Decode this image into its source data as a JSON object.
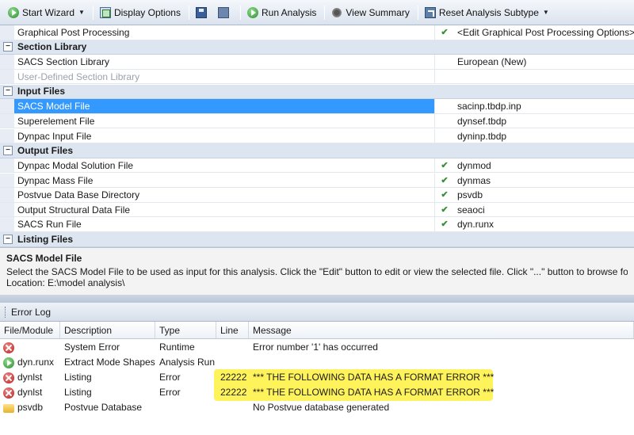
{
  "toolbar": {
    "start_wizard": "Start Wizard",
    "display_options": "Display Options",
    "run_analysis": "Run Analysis",
    "view_summary": "View Summary",
    "reset_subtype": "Reset Analysis Subtype"
  },
  "grid": {
    "rows": [
      {
        "type": "prop",
        "name": "Graphical Post Processing",
        "check": "✔",
        "value": "<Edit Graphical Post Processing Options>"
      },
      {
        "type": "cat",
        "name": "Section Library"
      },
      {
        "type": "prop",
        "name": "SACS Section Library",
        "check": "",
        "value": "European (New)"
      },
      {
        "type": "prop",
        "name": "User-Defined Section Library",
        "check": "",
        "value": "",
        "disabled": true
      },
      {
        "type": "cat",
        "name": "Input Files"
      },
      {
        "type": "prop",
        "name": "SACS Model File",
        "check": "",
        "value": "sacinp.tbdp.inp",
        "selected": true
      },
      {
        "type": "prop",
        "name": "Superelement File",
        "check": "",
        "value": "dynsef.tbdp"
      },
      {
        "type": "prop",
        "name": "Dynpac Input File",
        "check": "",
        "value": "dyninp.tbdp"
      },
      {
        "type": "cat",
        "name": "Output Files"
      },
      {
        "type": "prop",
        "name": "Dynpac Modal Solution File",
        "check": "✔",
        "value": "dynmod"
      },
      {
        "type": "prop",
        "name": "Dynpac Mass File",
        "check": "✔",
        "value": "dynmas"
      },
      {
        "type": "prop",
        "name": "Postvue Data Base Directory",
        "check": "✔",
        "value": "psvdb"
      },
      {
        "type": "prop",
        "name": "Output Structural Data File",
        "check": "✔",
        "value": "seaoci"
      },
      {
        "type": "prop",
        "name": "SACS Run File",
        "check": "✔",
        "value": "dyn.runx"
      },
      {
        "type": "cat",
        "name": "Listing Files"
      }
    ]
  },
  "description": {
    "title": "SACS Model File",
    "text": "Select the SACS Model File to be used as input for this analysis.  Click the \"Edit\" button to edit or view the selected file. Click \"...\" button to browse for an",
    "location": "Location: E:\\model analysis\\"
  },
  "error_log": {
    "title": "Error Log",
    "columns": [
      "File/Module",
      "Description",
      "Type",
      "Line",
      "Message"
    ],
    "rows": [
      {
        "icon": "error-icon",
        "module": "",
        "description": "System Error",
        "type": "Runtime",
        "line": "",
        "message": "Error number '1' has occurred"
      },
      {
        "icon": "run-icon",
        "module": "dyn.runx",
        "description": "Extract Mode Shapes",
        "type": "Analysis Run",
        "line": "",
        "message": ""
      },
      {
        "icon": "error-icon",
        "module": "dynlst",
        "description": "Listing",
        "type": "Error",
        "line": "22222",
        "message": "*** THE FOLLOWING DATA HAS A FORMAT ERROR ***"
      },
      {
        "icon": "error-icon",
        "module": "dynlst",
        "description": "Listing",
        "type": "Error",
        "line": "22222",
        "message": "*** THE FOLLOWING DATA HAS A FORMAT ERROR ***"
      },
      {
        "icon": "folder-icon",
        "module": "psvdb",
        "description": "Postvue Database",
        "type": "",
        "line": "",
        "message": "No Postvue database generated"
      }
    ]
  }
}
